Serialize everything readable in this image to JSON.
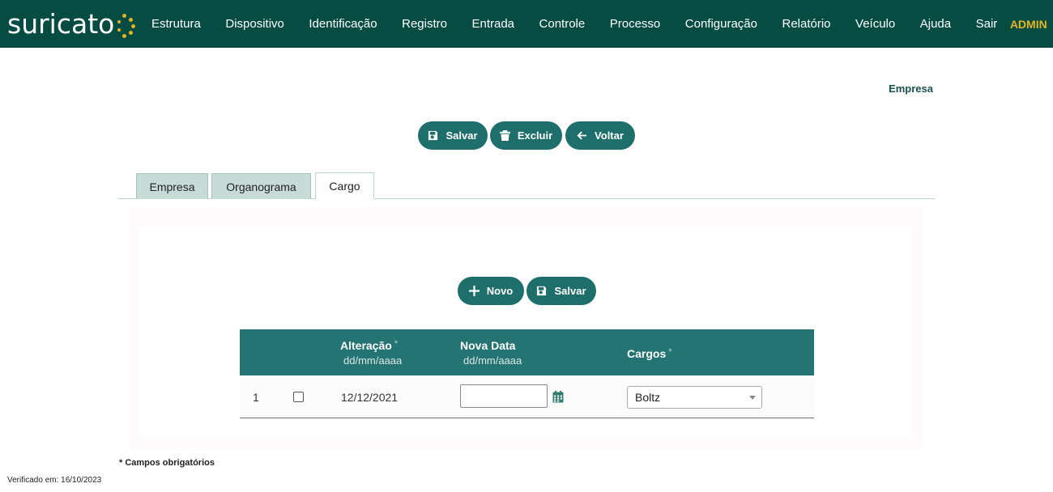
{
  "header": {
    "logo_text": "suricato",
    "nav": [
      "Estrutura",
      "Dispositivo",
      "Identificação",
      "Registro",
      "Entrada",
      "Controle",
      "Processo",
      "Configuração",
      "Relatório",
      "Veículo",
      "Ajuda",
      "Sair"
    ],
    "user": "ADMIN",
    "colors": {
      "bar": "#064c43",
      "accent": "#e4b425"
    }
  },
  "page": {
    "title": "Empresa"
  },
  "toolbar": {
    "save": "Salvar",
    "delete": "Excluir",
    "back": "Voltar"
  },
  "tabs": [
    {
      "label": "Empresa",
      "active": false
    },
    {
      "label": "Organograma",
      "active": false
    },
    {
      "label": "Cargo",
      "active": true
    }
  ],
  "cargo": {
    "new_label": "Novo",
    "save_label": "Salvar",
    "columns": {
      "alteracao": {
        "label": "Alteração",
        "sub": "dd/mm/aaaa",
        "required": "*"
      },
      "nova_data": {
        "label": "Nova Data",
        "sub": "dd/mm/aaaa"
      },
      "cargos": {
        "label": "Cargos",
        "required": "*"
      }
    },
    "rows": [
      {
        "index": "1",
        "checked": false,
        "alteracao": "12/12/2021",
        "nova_data": "",
        "cargo": "Boltz"
      }
    ]
  },
  "footer": {
    "required_note": "* Campos obrigatórios",
    "verified": "Verificado em: 16/10/2023"
  }
}
